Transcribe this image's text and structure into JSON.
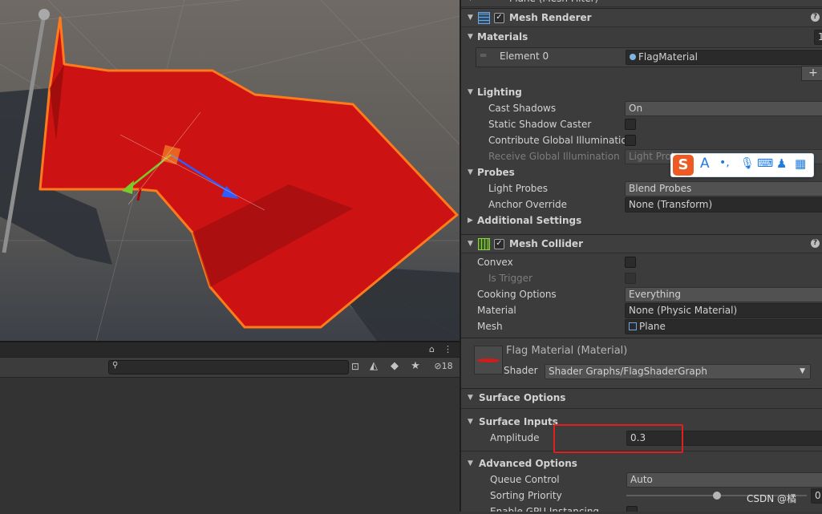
{
  "inspector": {
    "top_partial": "Plane (Mesh Filter)",
    "mesh_renderer": {
      "title": "Mesh Renderer",
      "materials_label": "Materials",
      "materials_count": "1",
      "element0_label": "Element 0",
      "element0_value": "FlagMaterial",
      "add_label": "+",
      "lighting_label": "Lighting",
      "cast_shadows_label": "Cast Shadows",
      "cast_shadows_value": "On",
      "static_shadow_label": "Static Shadow Caster",
      "contribute_gi_label": "Contribute Global Illumination",
      "receive_gi_label": "Receive Global Illumination",
      "receive_gi_value": "Light Probes",
      "probes_label": "Probes",
      "light_probes_label": "Light Probes",
      "light_probes_value": "Blend Probes",
      "anchor_override_label": "Anchor Override",
      "anchor_override_value": "None (Transform)",
      "additional_settings_label": "Additional Settings"
    },
    "mesh_collider": {
      "title": "Mesh Collider",
      "convex_label": "Convex",
      "is_trigger_label": "Is Trigger",
      "cooking_label": "Cooking Options",
      "cooking_value": "Everything",
      "material_label": "Material",
      "material_value": "None (Physic Material)",
      "mesh_label": "Mesh",
      "mesh_value": "Plane"
    },
    "material": {
      "title": "Flag Material (Material)",
      "shader_label": "Shader",
      "shader_value": "Shader Graphs/FlagShaderGraph",
      "surface_options_label": "Surface Options",
      "surface_inputs_label": "Surface Inputs",
      "amplitude_label": "Amplitude",
      "amplitude_value": "0.3",
      "advanced_label": "Advanced Options",
      "queue_control_label": "Queue Control",
      "queue_control_value": "Auto",
      "sorting_priority_label": "Sorting Priority",
      "sorting_priority_value": "0",
      "gpu_instancing_label": "Enable GPU Instancing"
    }
  },
  "project": {
    "hidden_count": "18"
  },
  "ime": {
    "letter_a": "A",
    "dot": "•,"
  },
  "watermark": "CSDN @橘"
}
